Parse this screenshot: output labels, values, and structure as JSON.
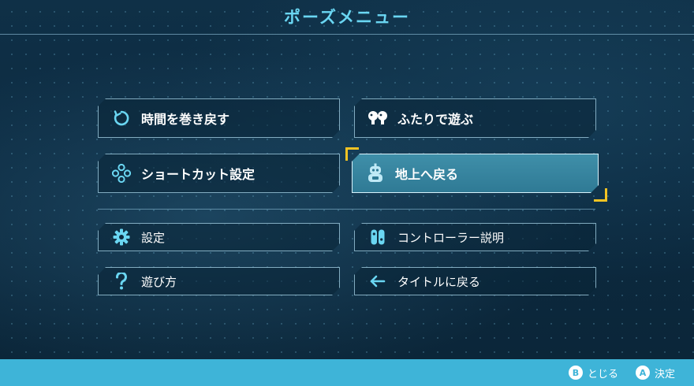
{
  "title": "ポーズメニュー",
  "menu": {
    "rewind": {
      "label": "時間を巻き戻す",
      "icon": "rewind-icon"
    },
    "two_player": {
      "label": "ふたりで遊ぶ",
      "icon": "two-players-icon"
    },
    "shortcut": {
      "label": "ショートカット設定",
      "icon": "dpad-buttons-icon"
    },
    "return_ground": {
      "label": "地上へ戻る",
      "icon": "robot-icon"
    },
    "settings": {
      "label": "設定",
      "icon": "gear-icon"
    },
    "controller": {
      "label": "コントローラー説明",
      "icon": "joycon-icon"
    },
    "how_to_play": {
      "label": "遊び方",
      "icon": "question-icon"
    },
    "back_to_title": {
      "label": "タイトルに戻る",
      "icon": "arrow-left-icon"
    }
  },
  "footer": {
    "close": {
      "button": "B",
      "label": "とじる"
    },
    "confirm": {
      "button": "A",
      "label": "決定"
    }
  },
  "colors": {
    "accent_cyan": "#6ad6f2",
    "selected_fill": "#3f8fa9",
    "selection_bracket": "#f3c323",
    "footer_bar": "#3eb4d8"
  }
}
